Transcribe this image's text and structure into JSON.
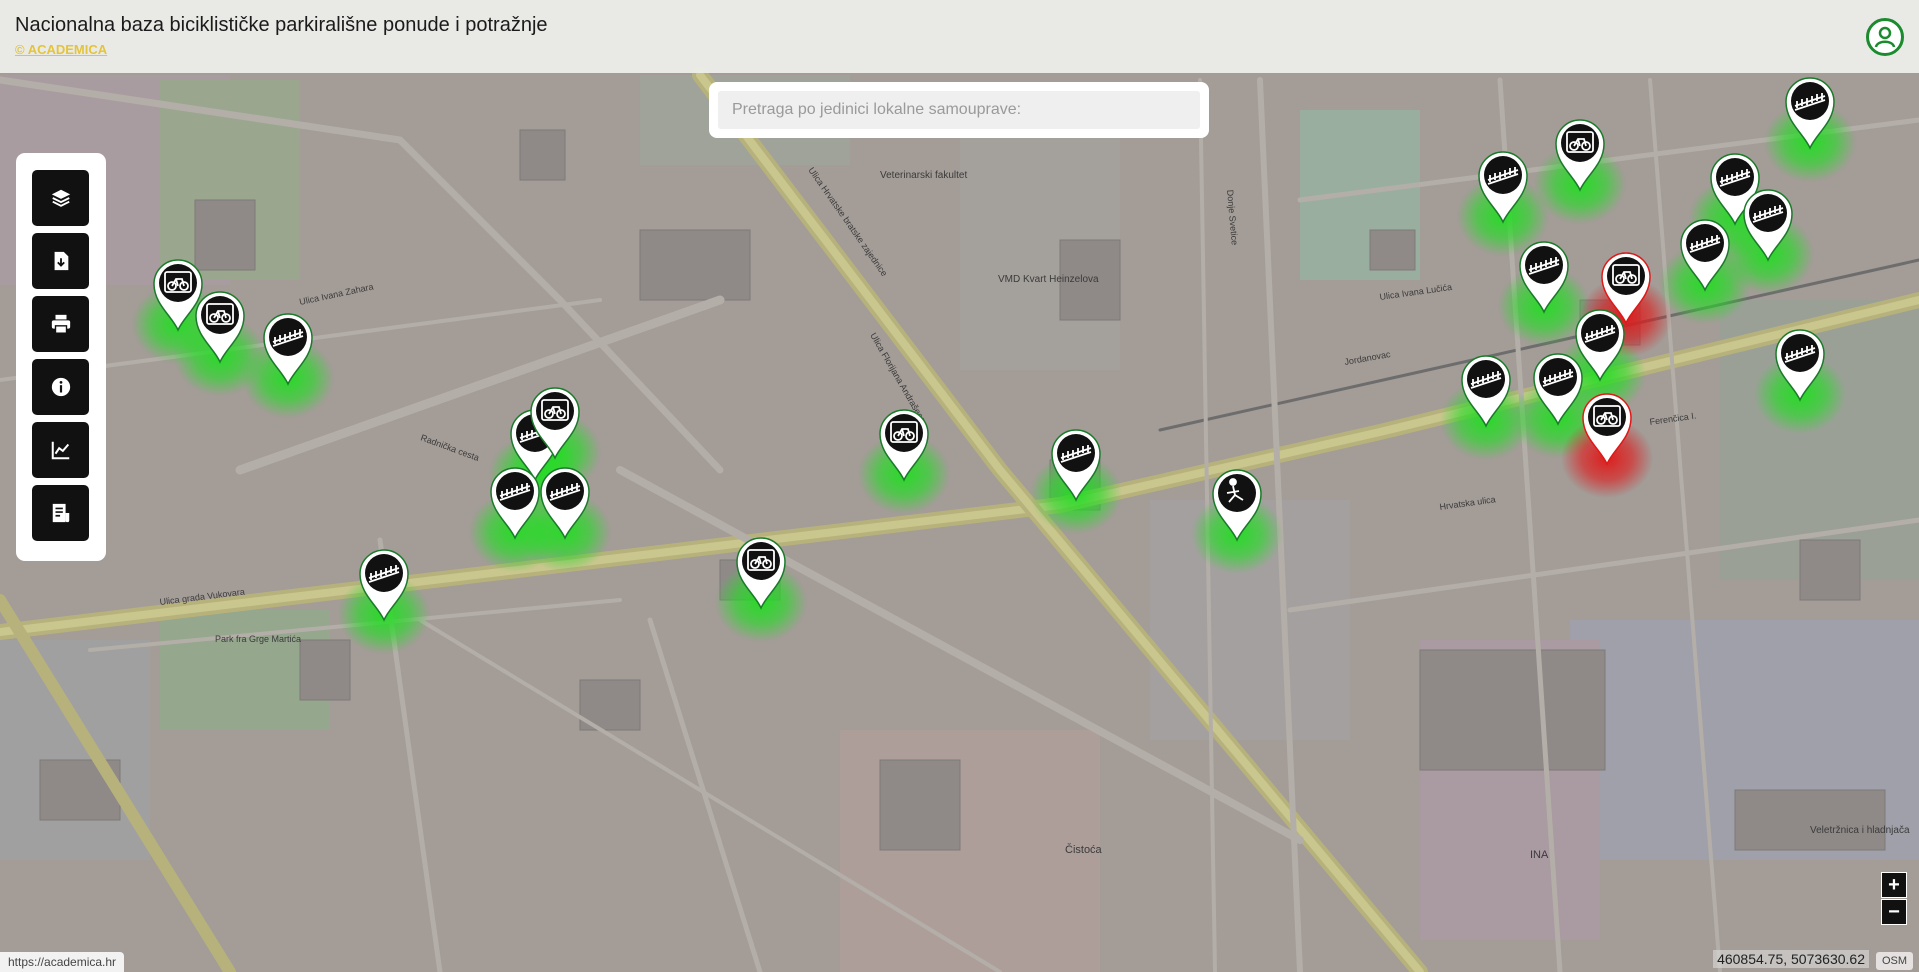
{
  "app": {
    "title": "Nacionalna baza biciklističke parkirališne ponude i potražnje",
    "brand_link": "© ACADEMICA",
    "status_url": "https://academica.hr"
  },
  "search": {
    "placeholder": "Pretraga po jedinici lokalne samouprave:",
    "value": ""
  },
  "toolbar": {
    "buttons": [
      {
        "name": "layers-button",
        "icon": "layers-icon"
      },
      {
        "name": "download-button",
        "icon": "download-icon"
      },
      {
        "name": "print-button",
        "icon": "print-icon"
      },
      {
        "name": "info-button",
        "icon": "info-icon"
      },
      {
        "name": "statistics-button",
        "icon": "chart-icon"
      },
      {
        "name": "report-button",
        "icon": "report-icon"
      }
    ]
  },
  "map": {
    "coordinates": "460854.75, 5073630.62",
    "attribution": "OSM",
    "zoom_in": "+",
    "zoom_out": "−",
    "colors": {
      "ok": "#22dd22",
      "alert": "#e01818",
      "marker": "#111111"
    },
    "street_labels": [
      "Ulica grada Vukovara",
      "Radnička cesta",
      "Ulica Ivana Zahara",
      "Ulica Hrvatske bratske zajednice",
      "Ulica Florijana Andrašeca",
      "Jordanovac",
      "Ulica Ivana Lučića",
      "Ferenčica I.",
      "Donje Svetice",
      "Hrvatska ulica",
      "VMD Kvart Heinzelova",
      "Veterinarski fakultet",
      "Čistoća",
      "Veletržnica i hladnjača",
      "INA",
      "Park fra Grge Martića"
    ]
  }
}
